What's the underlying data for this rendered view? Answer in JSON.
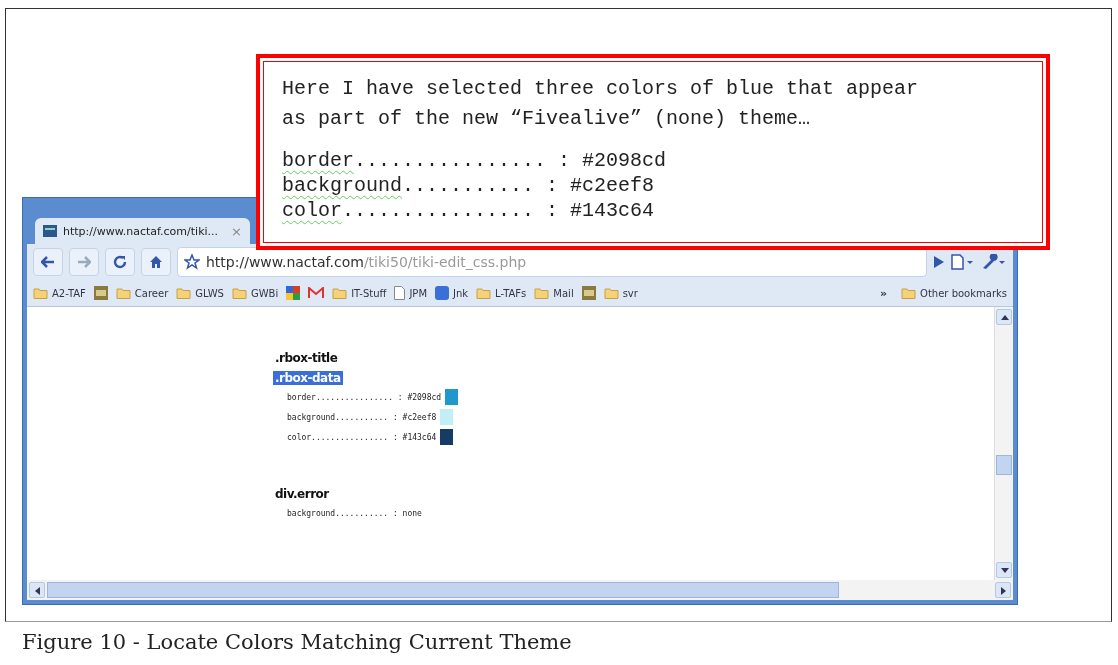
{
  "callout": {
    "intro": [
      "Here I have selected three colors of blue that appear",
      "as part of the new “Fivealive” (none) theme…"
    ],
    "lines": [
      {
        "name": "border",
        "dots": "................",
        "value": ": #2098cd",
        "spellcheck": true
      },
      {
        "name": "background",
        "dots": "...........",
        "value": ": #c2eef8",
        "spellcheck": true
      },
      {
        "name": "color",
        "dots": "................",
        "value": ": #143c64",
        "spellcheck": true
      }
    ]
  },
  "browser": {
    "tab": {
      "title": "http://www.nactaf.com/tiki...",
      "close": "×"
    },
    "address": {
      "host": "http://www.nactaf.com",
      "path": "/tiki50/tiki-edit_css.php"
    },
    "bookmarks": [
      {
        "kind": "folder",
        "label": "A2-TAF"
      },
      {
        "kind": "image"
      },
      {
        "kind": "folder",
        "label": "Career"
      },
      {
        "kind": "folder",
        "label": "GLWS"
      },
      {
        "kind": "folder",
        "label": "GWBi"
      },
      {
        "kind": "multicolor"
      },
      {
        "kind": "mail"
      },
      {
        "kind": "folder",
        "label": "IT-Stuff"
      },
      {
        "kind": "page",
        "label": "JPM"
      },
      {
        "kind": "app",
        "label": "Jnk"
      },
      {
        "kind": "folder",
        "label": "L-TAFs"
      },
      {
        "kind": "folder",
        "label": "Mail"
      },
      {
        "kind": "image"
      },
      {
        "kind": "folder",
        "label": "svr"
      }
    ],
    "overflow": "»",
    "other_bookmarks": "Other bookmarks",
    "css": [
      {
        "kind": "selector",
        "text": ".rbox-title",
        "selected": false
      },
      {
        "kind": "selector",
        "text": ".rbox-data",
        "selected": true
      },
      {
        "kind": "property",
        "text": "border................ : #2098cd",
        "color": "#2098cd"
      },
      {
        "kind": "property",
        "text": "background........... : #c2eef8",
        "color": "#c2eef8"
      },
      {
        "kind": "property",
        "text": "color................ : #143c64",
        "color": "#143c64"
      },
      {
        "kind": "gap"
      },
      {
        "kind": "selector",
        "text": "div.error",
        "selected": false
      },
      {
        "kind": "property",
        "text": "background........... : none"
      }
    ]
  },
  "caption": "Figure 10 - Locate Colors Matching Current Theme"
}
